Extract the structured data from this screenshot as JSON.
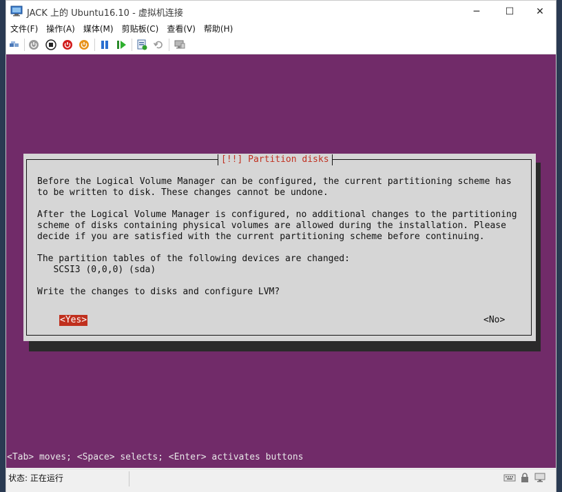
{
  "window": {
    "title": "JACK 上的 Ubuntu16.10 - 虚拟机连接",
    "controls": {
      "minimize": "─",
      "maximize": "☐",
      "close": "✕"
    }
  },
  "menu": [
    "文件(F)",
    "操作(A)",
    "媒体(M)",
    "剪贴板(C)",
    "查看(V)",
    "帮助(H)"
  ],
  "toolbar": {
    "icons": [
      "ctrl-alt-del-icon",
      "start-icon",
      "turn-off-icon",
      "shut-down-icon",
      "save-icon",
      "pause-icon",
      "resume-icon",
      "checkpoint-icon",
      "revert-icon",
      "enhanced-session-icon"
    ]
  },
  "installer": {
    "dialog_title": "[!!] Partition disks",
    "paragraph1": "Before the Logical Volume Manager can be configured, the current partitioning scheme has\nto be written to disk. These changes cannot be undone.",
    "paragraph2": "After the Logical Volume Manager is configured, no additional changes to the partitioning\nscheme of disks containing physical volumes are allowed during the installation. Please\ndecide if you are satisfied with the current partitioning scheme before continuing.",
    "paragraph3": "The partition tables of the following devices are changed:\n   SCSI3 (0,0,0) (sda)",
    "question": "Write the changes to disks and configure LVM?",
    "yes_button": "<Yes>",
    "no_button": "<No>",
    "hint": "<Tab> moves; <Space> selects; <Enter> activates buttons"
  },
  "status": {
    "text": "状态: 正在运行"
  },
  "colors": {
    "console_bg": "#712b69",
    "dialog_bg": "#d6d6d6",
    "dialog_title": "#c03020",
    "selected_button": "#c0301e"
  }
}
